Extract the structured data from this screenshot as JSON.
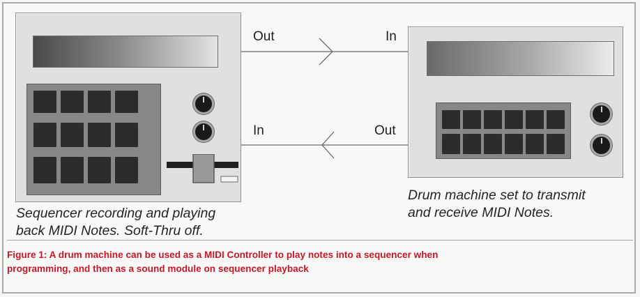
{
  "sequencer": {
    "out_label": "Out",
    "in_label": "In",
    "caption_line1": "Sequencer recording and playing",
    "caption_line2": "back MIDI Notes. Soft-Thru off."
  },
  "drum_machine": {
    "in_label": "In",
    "out_label": "Out",
    "caption_line1": "Drum machine set to transmit",
    "caption_line2": "and receive MIDI Notes."
  },
  "figure_caption_line1": "Figure 1: A drum machine can be used as a MIDI Controller to play notes into a sequencer when",
  "figure_caption_line2": "programming, and then as a sound module on sequencer playback",
  "colors": {
    "device_body": "#e0e0df",
    "pad": "#2c2c2c",
    "caption_red": "#c21a27"
  }
}
